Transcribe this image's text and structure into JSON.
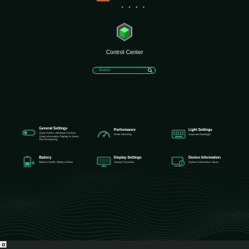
{
  "app": {
    "title": "Control Center"
  },
  "search": {
    "placeholder": "Search"
  },
  "cards": [
    {
      "name": "General Settings",
      "desc": [
        "Quick Switch, Windows Devices,",
        "Quick Information Display in Game,",
        "Key Remapping"
      ],
      "icon": "toggle-icon"
    },
    {
      "name": "Performance",
      "desc": [
        "Mode Selecting"
      ],
      "icon": "speedometer-icon"
    },
    {
      "name": "Light Settings",
      "desc": [
        "Keyboard Backlight"
      ],
      "icon": "keyboard-icon"
    },
    {
      "name": "Battery",
      "desc": [
        "Battery Health, Battery Status"
      ],
      "icon": "battery-icon"
    },
    {
      "name": "Display Settings",
      "desc": [
        "Display Functions"
      ],
      "icon": "monitor-icon"
    },
    {
      "name": "Device Information",
      "desc": [
        "System Information, About"
      ],
      "icon": "device-info-icon"
    }
  ],
  "colors": {
    "accent": "#2fb58a",
    "background": "#071410",
    "logo": "#22d84a"
  }
}
